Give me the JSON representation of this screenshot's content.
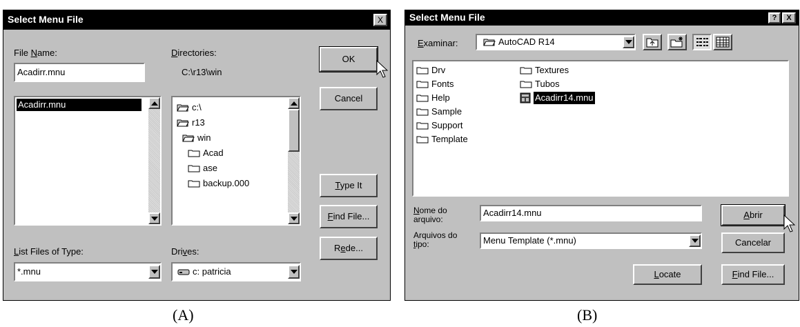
{
  "dialog_a": {
    "title": "Select Menu File",
    "close_glyph": "X",
    "file_name": {
      "label_pre": "File ",
      "label_key": "N",
      "label_post": "ame:",
      "value": "Acadirr.mnu"
    },
    "file_list": [
      "Acadirr.mnu"
    ],
    "directories": {
      "label_key": "D",
      "label_post": "irectories:",
      "current": "C:\\r13\\win",
      "items": [
        "c:\\",
        "r13",
        "win",
        "Acad",
        "ase",
        "backup.000"
      ]
    },
    "list_type": {
      "label_key": "L",
      "label_post": "ist Files of Type:",
      "value": "*.mnu"
    },
    "drives": {
      "label_pre": "Dri",
      "label_key": "v",
      "label_post": "es:",
      "value": "c: patricia"
    },
    "buttons": {
      "ok": "OK",
      "cancel": "Cancel",
      "type_it_key": "T",
      "type_it_rest": "ype It",
      "find_file_key": "F",
      "find_file_rest": "ind File...",
      "rede_pre": "R",
      "rede_key": "e",
      "rede_post": "de..."
    },
    "caption": "(A)"
  },
  "dialog_b": {
    "title": "Select Menu File",
    "help_glyph": "?",
    "close_glyph": "X",
    "look_in": {
      "label_key": "E",
      "label_post": "xaminar:",
      "value": "AutoCAD R14"
    },
    "files_col1": [
      "Drv",
      "Fonts",
      "Help",
      "Sample",
      "Support",
      "Template"
    ],
    "files_col2": [
      "Textures",
      "Tubos",
      "Acadirr14.mnu"
    ],
    "file_name": {
      "label_key": "N",
      "label_post": "ome do",
      "label_line2": "arquivo:",
      "value": "Acadirr14.mnu"
    },
    "file_type": {
      "label_line1": "Arquivos do",
      "label_key": "t",
      "label_post": "ipo:",
      "value": "Menu Template (*.mnu)"
    },
    "buttons": {
      "abrir_key": "A",
      "abrir_rest": "brir",
      "cancelar": "Cancelar",
      "locate_key": "L",
      "locate_rest": "ocate",
      "find_file_key": "F",
      "find_file_rest": "ind File..."
    },
    "caption": "(B)"
  },
  "colors": {
    "titlebar": "#000000",
    "face": "#c0c0c0",
    "window": "#ffffff",
    "shadow": "#808080"
  },
  "icons": [
    "folder-icon",
    "open-folder-icon",
    "drive-icon",
    "menu-file-icon",
    "up-folder-icon",
    "new-folder-icon",
    "list-view-icon",
    "details-view-icon",
    "mouse-cursor-icon"
  ]
}
